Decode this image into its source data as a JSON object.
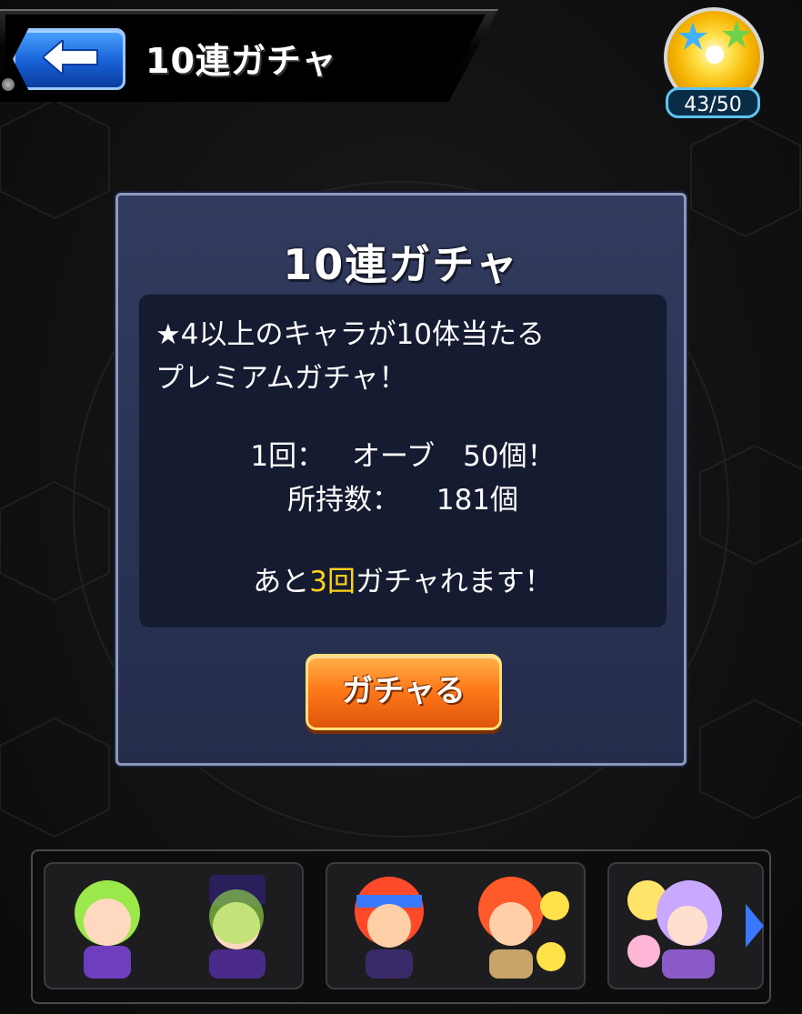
{
  "header": {
    "title": "10連ガチャ",
    "back_icon": "arrow-left-icon"
  },
  "orbs": {
    "icon": "orb-icon",
    "count": "43/50"
  },
  "dialog": {
    "title": "10連ガチャ",
    "description_line1": "★4以上のキャラが10体当たる",
    "description_line2": "プレミアムガチャ！",
    "cost_label": "1回：",
    "cost_value": "オーブ　50個！",
    "owned_label": "所持数：",
    "owned_value": "181個",
    "remain_prefix": "あと",
    "remain_count": "3回",
    "remain_suffix": "ガチャれます！",
    "gacha_button": "ガチャる"
  },
  "carousel": {
    "cards": [
      {
        "name": "character-card-1",
        "accent": "#7ad63a"
      },
      {
        "name": "character-card-2",
        "accent": "#ff5a2a"
      },
      {
        "name": "character-card-3",
        "accent": "#c79bff"
      }
    ],
    "next_icon": "chevron-right-icon"
  }
}
